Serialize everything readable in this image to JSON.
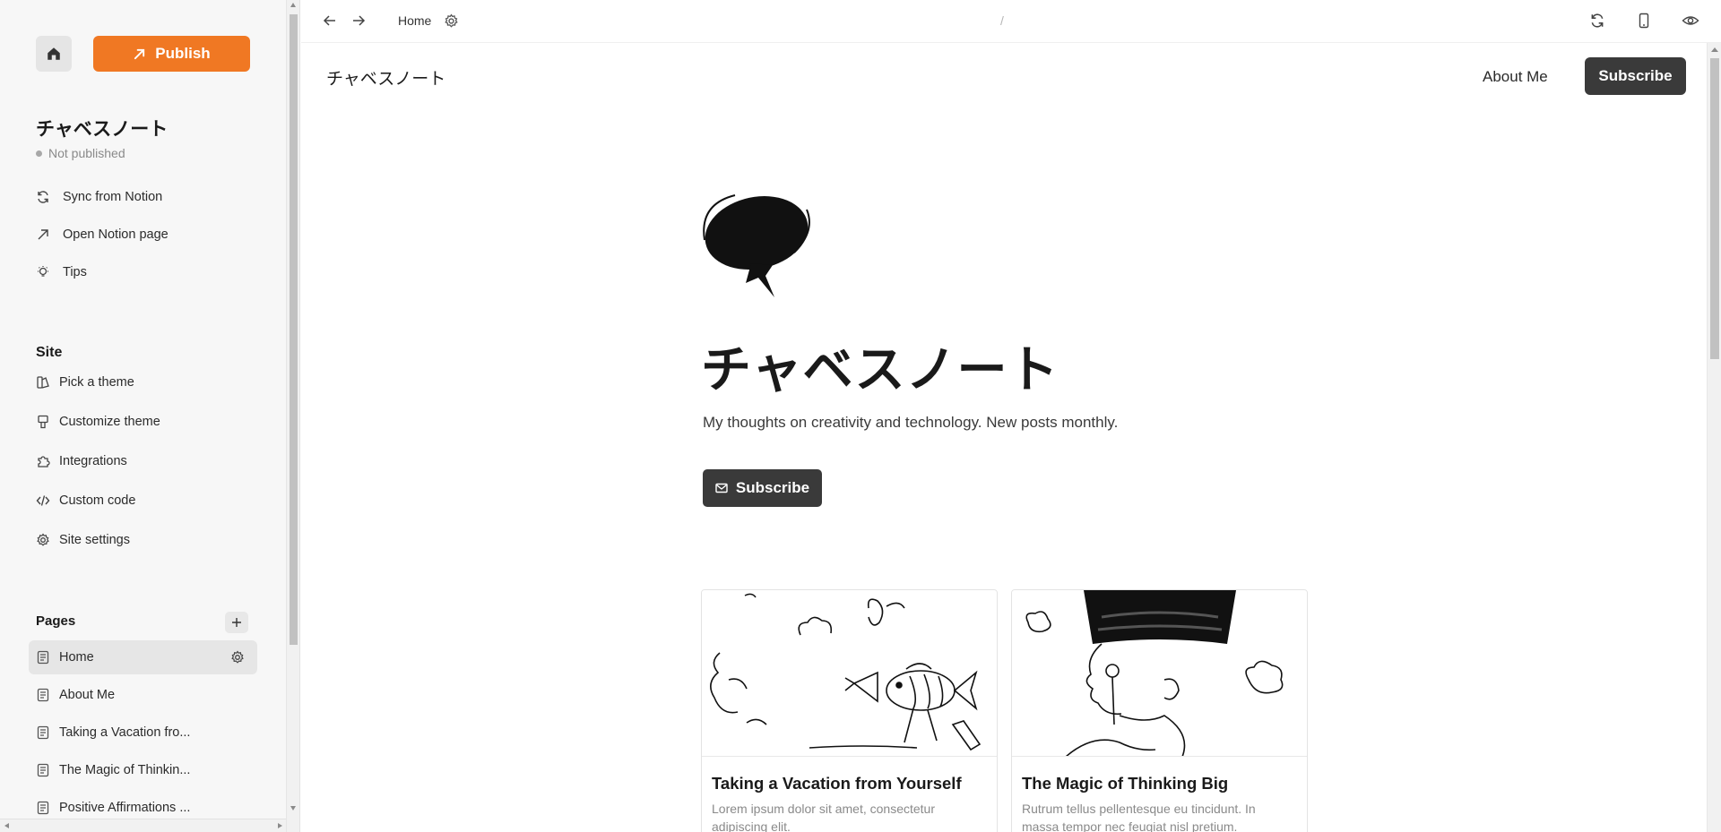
{
  "sidebar": {
    "publish_label": "Publish",
    "site_name": "チャベスノート",
    "status": "Not published",
    "actions": [
      {
        "label": "Sync from Notion",
        "icon": "sync-icon"
      },
      {
        "label": "Open Notion page",
        "icon": "arrow-up-right-icon"
      },
      {
        "label": "Tips",
        "icon": "lightbulb-icon"
      }
    ],
    "site_section": "Site",
    "site_items": [
      {
        "label": "Pick a theme",
        "icon": "theme-icon"
      },
      {
        "label": "Customize theme",
        "icon": "brush-icon"
      },
      {
        "label": "Integrations",
        "icon": "puzzle-icon"
      },
      {
        "label": "Custom code",
        "icon": "code-icon"
      },
      {
        "label": "Site settings",
        "icon": "gear-icon"
      }
    ],
    "pages_section": "Pages",
    "pages": [
      {
        "label": "Home",
        "active": true
      },
      {
        "label": "About Me"
      },
      {
        "label": "Taking a Vacation fro..."
      },
      {
        "label": "The Magic of Thinkin..."
      },
      {
        "label": "Positive Affirmations ..."
      }
    ]
  },
  "toolbar": {
    "current_page": "Home",
    "path": "/"
  },
  "preview": {
    "brand": "チャベスノート",
    "nav_about": "About Me",
    "nav_subscribe": "Subscribe",
    "hero_title": "チャベスノート",
    "hero_description": "My thoughts on creativity and technology. New posts monthly.",
    "hero_subscribe": "Subscribe",
    "posts": [
      {
        "title": "Taking a Vacation from Yourself",
        "excerpt": "Lorem ipsum dolor sit amet, consectetur adipiscing elit."
      },
      {
        "title": "The Magic of Thinking Big",
        "excerpt": "Rutrum tellus pellentesque eu tincidunt. In massa tempor nec feugiat nisl pretium."
      }
    ]
  },
  "colors": {
    "accent": "#f07823",
    "dark_button": "#3a3a3a"
  }
}
